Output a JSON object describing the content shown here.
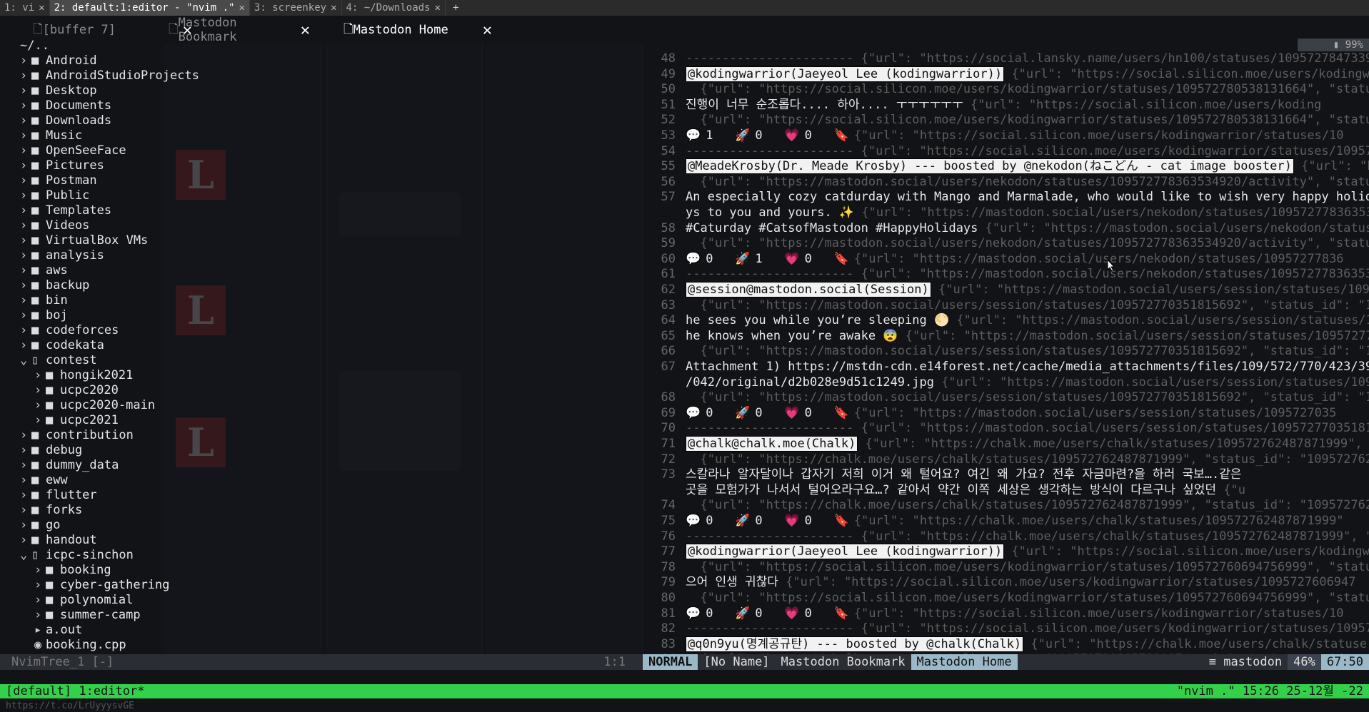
{
  "wm_tabs": [
    {
      "label": "1: vi"
    },
    {
      "label": "2: default:1:editor - \"nvim .\""
    },
    {
      "label": "3: screenkey"
    },
    {
      "label": "4: ~/Downloads"
    }
  ],
  "wm_add": "+",
  "buffers": [
    {
      "icon": "🗋",
      "label": "[buffer 7]"
    },
    {
      "icon": "🗋",
      "label": "Mastodon Bookmark"
    },
    {
      "icon": "🗋",
      "label": "Mastodon Home"
    }
  ],
  "tree": {
    "root": "~/..",
    "items": [
      {
        "name": "Android",
        "depth": 0
      },
      {
        "name": "AndroidStudioProjects",
        "depth": 0
      },
      {
        "name": "Desktop",
        "depth": 0
      },
      {
        "name": "Documents",
        "depth": 0
      },
      {
        "name": "Downloads",
        "depth": 0
      },
      {
        "name": "Music",
        "depth": 0
      },
      {
        "name": "OpenSeeFace",
        "depth": 0
      },
      {
        "name": "Pictures",
        "depth": 0
      },
      {
        "name": "Postman",
        "depth": 0
      },
      {
        "name": "Public",
        "depth": 0
      },
      {
        "name": "Templates",
        "depth": 0
      },
      {
        "name": "Videos",
        "depth": 0
      },
      {
        "name": "VirtualBox VMs",
        "depth": 0
      },
      {
        "name": "analysis",
        "depth": 0
      },
      {
        "name": "aws",
        "depth": 0
      },
      {
        "name": "backup",
        "depth": 0
      },
      {
        "name": "bin",
        "depth": 0
      },
      {
        "name": "boj",
        "depth": 0
      },
      {
        "name": "codeforces",
        "depth": 0
      },
      {
        "name": "codekata",
        "depth": 0
      },
      {
        "name": "contest",
        "depth": 0,
        "open": true
      },
      {
        "name": "hongik2021",
        "depth": 1
      },
      {
        "name": "ucpc2020",
        "depth": 1
      },
      {
        "name": "ucpc2020-main",
        "depth": 1
      },
      {
        "name": "ucpc2021",
        "depth": 1
      },
      {
        "name": "contribution",
        "depth": 0
      },
      {
        "name": "debug",
        "depth": 0
      },
      {
        "name": "dummy_data",
        "depth": 0
      },
      {
        "name": "eww",
        "depth": 0
      },
      {
        "name": "flutter",
        "depth": 0
      },
      {
        "name": "forks",
        "depth": 0
      },
      {
        "name": "go",
        "depth": 0
      },
      {
        "name": "handout",
        "depth": 0
      },
      {
        "name": "icpc-sinchon",
        "depth": 0,
        "open": true
      },
      {
        "name": "booking",
        "depth": 1
      },
      {
        "name": "cyber-gathering",
        "depth": 1
      },
      {
        "name": "polynomial",
        "depth": 1
      },
      {
        "name": "summer-camp",
        "depth": 1
      },
      {
        "name": "a.out",
        "depth": 1,
        "file": true
      },
      {
        "name": "booking.cpp",
        "depth": 1,
        "file": true
      }
    ],
    "status_left": "NvimTree_1 [-]",
    "status_pos": "1:1"
  },
  "editor": {
    "scroll_badge": "99%",
    "lines": [
      {
        "n": "48",
        "type": "dim",
        "text": "----------------------- {\"url\": \"https://social.lansky.name/users/hn100/statuses/10957278473392"
      },
      {
        "n": "49",
        "type": "header",
        "header": "@kodingwarrior(Jaeyeol Lee (kodingwarrior))",
        "rest": " {\"url\": \"https://social.silicon.moe/users/kodingwar"
      },
      {
        "n": "50",
        "type": "dim",
        "text": "  {\"url\": \"https://social.silicon.moe/users/kodingwarrior/statuses/109572780538131664\", \"status_"
      },
      {
        "n": "51",
        "type": "text",
        "text": "진행이 너무 순조롭다.... 하아.... ㅜㅜㅜㅜㅜㅜ",
        "rest": " {\"url\": \"https://social.silicon.moe/users/koding"
      },
      {
        "n": "52",
        "type": "dim",
        "text": "  {\"url\": \"https://social.silicon.moe/users/kodingwarrior/statuses/109572780538131664\", \"status_"
      },
      {
        "n": "53",
        "type": "stats",
        "reply": "1",
        "boost": "0",
        "fav": "0",
        "rest": " {\"url\": \"https://social.silicon.moe/users/kodingwarrior/statuses/10"
      },
      {
        "n": "54",
        "type": "dim",
        "text": "----------------------- {\"url\": \"https://social.silicon.moe/users/kodingwarrior/statuses/10957278"
      },
      {
        "n": "55",
        "type": "header",
        "header": "@MeadeKrosby(Dr. Meade Krosby) --- boosted by @nekodon(ねこどん - cat image booster)",
        "rest": " {\"url\": \"h"
      },
      {
        "n": "56",
        "type": "dim",
        "text": "  {\"url\": \"https://mastodon.social/users/nekodon/statuses/109572778363534920/activity\", \"status_"
      },
      {
        "n": "57",
        "type": "text",
        "text": "An especially cozy catdurday with Mango and Marmalade, who would like to wish very happy holida",
        "rest": ""
      },
      {
        "n": "",
        "type": "text",
        "text": "ys to you and yours. ✨",
        "rest": " {\"url\": \"https://mastodon.social/users/nekodon/statuses/10957277836353"
      },
      {
        "n": "58",
        "type": "text",
        "text": "#Caturday #CatsofMastodon #HappyHolidays",
        "rest": " {\"url\": \"https://mastodon.social/users/nekodon/statuse"
      },
      {
        "n": "59",
        "type": "dim",
        "text": "  {\"url\": \"https://mastodon.social/users/nekodon/statuses/109572778363534920/activity\", \"status_"
      },
      {
        "n": "60",
        "type": "stats",
        "reply": "0",
        "boost": "1",
        "fav": "0",
        "rest": " {\"url\": \"https://mastodon.social/users/nekodon/statuses/10957277836"
      },
      {
        "n": "61",
        "type": "dim",
        "text": "----------------------- {\"url\": \"https://mastodon.social/users/nekodon/statuses/109572778363534"
      },
      {
        "n": "62",
        "type": "header",
        "header": "@session@mastodon.social(Session)",
        "rest": " {\"url\": \"https://mastodon.social/users/session/statuses/10957"
      },
      {
        "n": "63",
        "type": "dim",
        "text": "  {\"url\": \"https://mastodon.social/users/session/statuses/109572770351815692\", \"status_id\": \"109"
      },
      {
        "n": "64",
        "type": "text",
        "text": "he sees you while you’re sleeping 🌕",
        "rest": " {\"url\": \"https://mastodon.social/users/session/statuses/10"
      },
      {
        "n": "65",
        "type": "text",
        "text": "he knows when you’re awake 😨",
        "rest": " {\"url\": \"https://mastodon.social/users/session/statuses/109572770"
      },
      {
        "n": "66",
        "type": "dim",
        "text": "  {\"url\": \"https://mastodon.social/users/session/statuses/109572770351815692\", \"status_id\": \"109"
      },
      {
        "n": "67",
        "type": "text",
        "text": "Attachment 1) https://mstdn-cdn.e14forest.net/cache/media_attachments/files/109/572/770/423/393",
        "rest": ""
      },
      {
        "n": "",
        "type": "text",
        "text": "/042/original/d2b028e9d51c1249.jpg",
        "rest": " {\"url\": \"https://mastodon.social/users/session/statuses/1095"
      },
      {
        "n": "68",
        "type": "dim",
        "text": "  {\"url\": \"https://mastodon.social/users/session/statuses/109572770351815692\", \"status_id\": \"109"
      },
      {
        "n": "69",
        "type": "stats",
        "reply": "0",
        "boost": "0",
        "fav": "0",
        "rest": " {\"url\": \"https://mastodon.social/users/session/statuses/1095727035"
      },
      {
        "n": "70",
        "type": "dim",
        "text": "----------------------- {\"url\": \"https://mastodon.social/users/session/statuses/109572770351815"
      },
      {
        "n": "71",
        "type": "header",
        "header": "@chalk@chalk.moe(Chalk)",
        "rest": " {\"url\": \"https://chalk.moe/users/chalk/statuses/109572762487871999\", \"s"
      },
      {
        "n": "72",
        "type": "dim",
        "text": "  {\"url\": \"https://chalk.moe/users/chalk/statuses/109572762487871999\", \"status_id\": \"1095727626"
      },
      {
        "n": "73",
        "type": "text",
        "text": "스칼라나 알자달이나 갑자기 저희 이거 왜 털어요? 여긴 왜 가요? 전후 자금마련?을 하러 국보….같은",
        "rest": ""
      },
      {
        "n": "",
        "type": "text",
        "text": "곳을 모험가가 나서서 털어오라구요…? 같아서 약간 이쪽 세상은 생각하는 방식이 다르구나 싶었던",
        "rest": " {\"u"
      },
      {
        "n": "74",
        "type": "dim",
        "text": "  {\"url\": \"https://chalk.moe/users/chalk/statuses/109572762487871999\", \"status_id\": \"1095727626"
      },
      {
        "n": "75",
        "type": "stats",
        "reply": "0",
        "boost": "0",
        "fav": "0",
        "rest": " {\"url\": \"https://chalk.moe/users/chalk/statuses/109572762487871999\""
      },
      {
        "n": "76",
        "type": "dim",
        "text": "----------------------- {\"url\": \"https://chalk.moe/users/chalk/statuses/109572762487871999\", \"s"
      },
      {
        "n": "77",
        "type": "header",
        "header": "@kodingwarrior(Jaeyeol Lee (kodingwarrior))",
        "rest": " {\"url\": \"https://social.silicon.moe/users/kodingwar"
      },
      {
        "n": "78",
        "type": "dim",
        "text": "  {\"url\": \"https://social.silicon.moe/users/kodingwarrior/statuses/109572760694756999\", \"status_"
      },
      {
        "n": "79",
        "type": "text",
        "text": "으어 인생 귀찮다",
        "rest": " {\"url\": \"https://social.silicon.moe/users/kodingwarrior/statuses/1095727606947"
      },
      {
        "n": "80",
        "type": "dim",
        "text": "  {\"url\": \"https://social.silicon.moe/users/kodingwarrior/statuses/109572760694756999\", \"status_"
      },
      {
        "n": "81",
        "type": "stats",
        "reply": "0",
        "boost": "0",
        "fav": "0",
        "rest": " {\"url\": \"https://social.silicon.moe/users/kodingwarrior/statuses/10"
      },
      {
        "n": "82",
        "type": "dim",
        "text": "----------------------- {\"url\": \"https://social.silicon.moe/users/kodingwarrior/statuses/10957272"
      },
      {
        "n": "83",
        "type": "header",
        "header": "@q0n9yu(명계공규탄) --- boosted by @chalk(Chalk)",
        "rest": " {\"url\": \"https://chalk.moe/users/chalk/statuse"
      },
      {
        "n": "84",
        "type": "dim",
        "text": "  {\"url\": \"https://chalk.moe/users/chalk/statuses/109572738165791927/activity\", \"status_id\": \"10"
      }
    ]
  },
  "statusline": {
    "mode": "NORMAL",
    "noname": "[No Name]",
    "bookmark": "Mastodon Bookmark",
    "home": "Mastodon Home",
    "filetype": "mastodon",
    "percent": "46%",
    "pos": "67:50"
  },
  "tmux": {
    "left": "[default] 1:editor*",
    "right": "\"nvim .\" 15:26 25-12월 -22"
  },
  "bottom_url": "https://t.co/LrUyyysvGE",
  "colors": {
    "tmux_green": "#33d04a",
    "statusline_accent": "#9ab8c8"
  }
}
